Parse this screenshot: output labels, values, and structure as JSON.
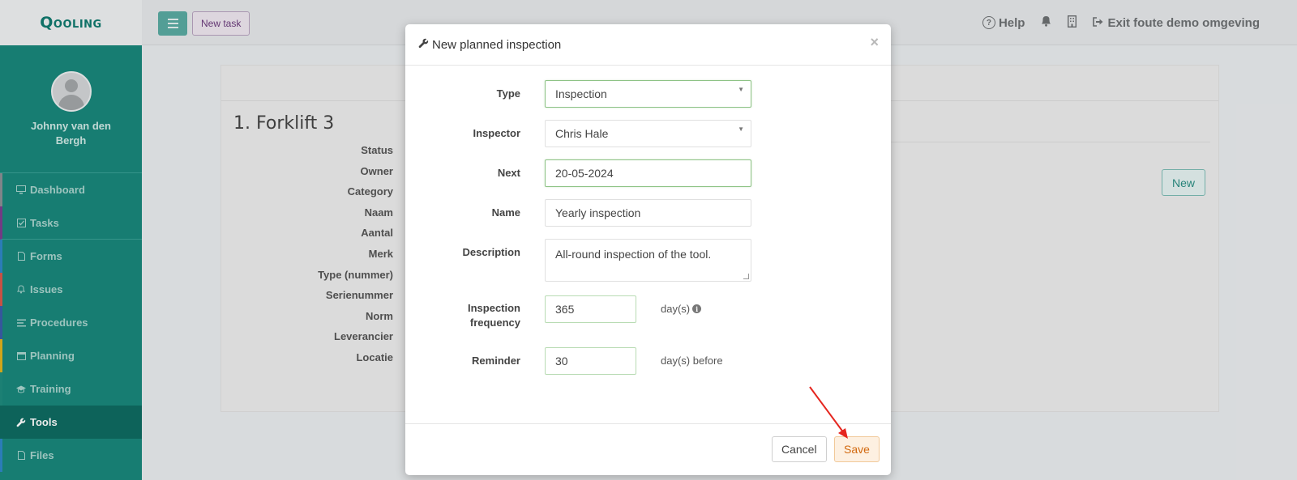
{
  "brand": {
    "logo_text": "Qooling",
    "accent": "#19877b",
    "active": "#0e6b61"
  },
  "sidebar": {
    "user_name": "Johnny van den Bergh",
    "items": [
      {
        "label": "Dashboard",
        "icon": "monitor-icon",
        "color": "#8a8f94"
      },
      {
        "label": "Tasks",
        "icon": "check-square-icon",
        "color": "#7b3f8f"
      },
      {
        "label": "Forms",
        "icon": "file-icon",
        "color": "#2f86c5"
      },
      {
        "label": "Issues",
        "icon": "bell-icon",
        "color": "#d8584a"
      },
      {
        "label": "Procedures",
        "icon": "list-icon",
        "color": "#3b5ea8"
      },
      {
        "label": "Planning",
        "icon": "calendar-icon",
        "color": "#e0b21c"
      },
      {
        "label": "Training",
        "icon": "graduation-cap-icon",
        "color": "#1f8a7d"
      },
      {
        "label": "Tools",
        "icon": "wrench-icon",
        "color": "#0e6b61"
      },
      {
        "label": "Files",
        "icon": "file-icon",
        "color": "#2f86c5"
      }
    ]
  },
  "topbar": {
    "new_task_label": "New task",
    "help_label": "Help",
    "exit_label": "Exit foute demo omgeving"
  },
  "page": {
    "title": "1. Forklift 3",
    "fields": [
      "Status",
      "Owner",
      "Category",
      "Naam",
      "Aantal",
      "Merk",
      "Type (nummer)",
      "Serienummer",
      "Norm",
      "Leverancier",
      "Locatie"
    ],
    "new_button_label": "New"
  },
  "modal": {
    "title": "New planned inspection",
    "type": {
      "label": "Type",
      "value": "Inspection"
    },
    "inspector": {
      "label": "Inspector",
      "value": "Chris Hale"
    },
    "next": {
      "label": "Next",
      "value": "20-05-2024"
    },
    "name": {
      "label": "Name",
      "value": "Yearly inspection"
    },
    "description": {
      "label": "Description",
      "value": "All-round inspection of the tool."
    },
    "frequency": {
      "label": "Inspection frequency",
      "value": "365",
      "suffix": "day(s)"
    },
    "reminder": {
      "label": "Reminder",
      "value": "30",
      "suffix": "day(s) before"
    },
    "cancel_label": "Cancel",
    "save_label": "Save"
  }
}
